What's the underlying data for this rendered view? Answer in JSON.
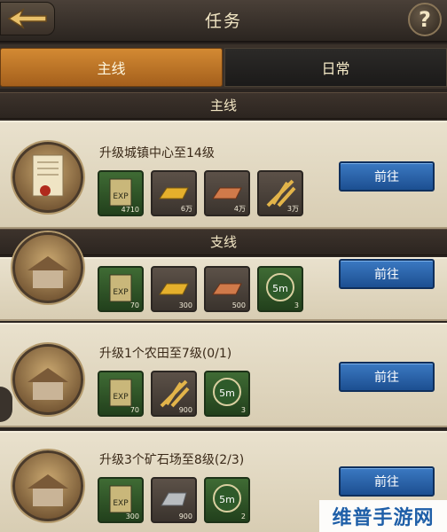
{
  "header": {
    "title": "任务",
    "back_icon": "back-arrow-icon",
    "help_label": "?"
  },
  "tabs": [
    {
      "label": "主线",
      "active": true
    },
    {
      "label": "日常",
      "active": false
    }
  ],
  "sections": {
    "main": "主线",
    "side": "支线"
  },
  "go_label": "前往",
  "quests": [
    {
      "title": "升级城镇中心至14级",
      "portrait": "scroll-icon",
      "rewards": [
        {
          "icon": "exp-icon",
          "qty": "4710",
          "green": true
        },
        {
          "icon": "gold-bar-icon",
          "qty": "6万",
          "green": false
        },
        {
          "icon": "copper-bar-icon",
          "qty": "4万",
          "green": false
        },
        {
          "icon": "wheat-icon",
          "qty": "3万",
          "green": false
        }
      ]
    },
    {
      "title": "",
      "portrait": "building-icon",
      "rewards": [
        {
          "icon": "exp-icon",
          "qty": "70",
          "green": true
        },
        {
          "icon": "gold-bar-icon",
          "qty": "300",
          "green": false
        },
        {
          "icon": "copper-bar-icon",
          "qty": "500",
          "green": false
        },
        {
          "icon": "speedup-5m-icon",
          "qty": "3",
          "green": true,
          "label": "5m"
        }
      ]
    },
    {
      "title": "升级1个农田至7级(0/1)",
      "portrait": "building-icon",
      "rewards": [
        {
          "icon": "exp-icon",
          "qty": "70",
          "green": true
        },
        {
          "icon": "wheat-icon",
          "qty": "900",
          "green": false
        },
        {
          "icon": "speedup-5m-icon",
          "qty": "3",
          "green": true,
          "label": "5m"
        }
      ]
    },
    {
      "title": "升级3个矿石场至8级(2/3)",
      "portrait": "building-icon",
      "rewards": [
        {
          "icon": "exp-icon",
          "qty": "300",
          "green": true
        },
        {
          "icon": "stone-icon",
          "qty": "900",
          "green": false
        },
        {
          "icon": "speedup-5m-icon",
          "qty": "2",
          "green": true,
          "label": "5m"
        }
      ]
    }
  ],
  "watermark": "维普手游网"
}
